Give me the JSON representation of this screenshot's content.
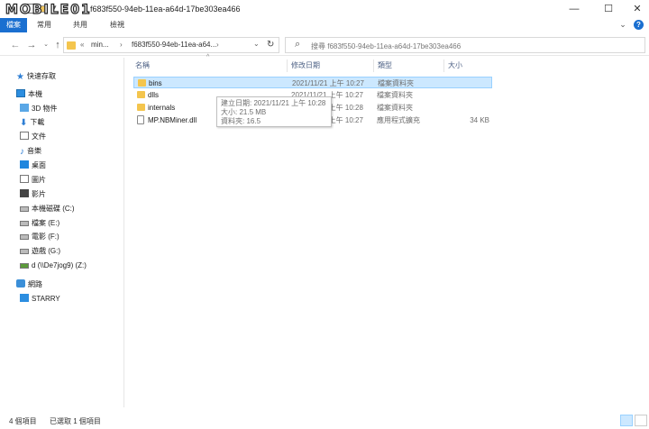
{
  "window": {
    "logo_text": "MOBILE01",
    "title": "f683f550-94eb-11ea-a64d-17be303ea466",
    "min": "—",
    "max": "☐",
    "close": "✕"
  },
  "ribbon": {
    "tabs": [
      "檔案",
      "常用",
      "共用",
      "檢視"
    ],
    "collapse": "⌄",
    "help": "?"
  },
  "nav": {
    "back": "←",
    "forward": "→",
    "recent": "⌄",
    "up": "↑"
  },
  "address": {
    "chev": "«",
    "crumb1": "min...",
    "sep": "›",
    "crumb2": "f683f550-94eb-11ea-a64...",
    "sep2": "›",
    "dropdown": "⌄",
    "refresh": "↻"
  },
  "search": {
    "placeholder": "搜尋 f683f550-94eb-11ea-a64d-17be303ea466",
    "icon": "⌕"
  },
  "sidebar": {
    "items": [
      {
        "label": "快速存取",
        "icon": "star-icon"
      },
      {
        "label": "本機",
        "icon": "computer-icon"
      },
      {
        "label": "3D 物件",
        "icon": "3d-objects-icon"
      },
      {
        "label": "下載",
        "icon": "download-icon"
      },
      {
        "label": "文件",
        "icon": "document-icon"
      },
      {
        "label": "音樂",
        "icon": "music-icon"
      },
      {
        "label": "桌面",
        "icon": "desktop-icon"
      },
      {
        "label": "圖片",
        "icon": "pictures-icon"
      },
      {
        "label": "影片",
        "icon": "video-icon"
      },
      {
        "label": "本機磁碟 (C:)",
        "icon": "drive-icon"
      },
      {
        "label": "檔案 (E:)",
        "icon": "drive-icon"
      },
      {
        "label": "電影 (F:)",
        "icon": "drive-icon"
      },
      {
        "label": "遊戲 (G:)",
        "icon": "drive-icon"
      },
      {
        "label": "d (\\\\De7jog9) (Z:)",
        "icon": "network-drive-icon"
      },
      {
        "label": "網路",
        "icon": "network-icon"
      },
      {
        "label": "STARRY",
        "icon": "computer-icon"
      }
    ]
  },
  "columns": {
    "name": "名稱",
    "date": "修改日期",
    "type": "類型",
    "size": "大小",
    "sort_indicator": "^"
  },
  "files": [
    {
      "name": "bins",
      "date": "2021/11/21 上午 10:27",
      "type": "檔案資料夾",
      "size": "",
      "kind": "folder"
    },
    {
      "name": "dlls",
      "date": "2021/11/21 上午 10:27",
      "type": "檔案資料夾",
      "size": "",
      "kind": "folder"
    },
    {
      "name": "internals",
      "date": "2021/11/21 上午 10:28",
      "type": "檔案資料夾",
      "size": "",
      "kind": "folder"
    },
    {
      "name": "MP.NBMiner.dll",
      "date": "2021/11/21 上午 10:27",
      "type": "應用程式擴充",
      "size": "34 KB",
      "kind": "dll"
    }
  ],
  "tooltip": {
    "line1": "建立日期: 2021/11/21 上午 10:28",
    "line2": "大小: 21.5 MB",
    "line3": "資料夾: 16.5"
  },
  "status": {
    "count": "4 個項目",
    "selected": "已選取 1 個項目"
  },
  "colors": {
    "accent": "#1a6fd0",
    "selection": "#cce8ff",
    "folder": "#f4c54d"
  }
}
